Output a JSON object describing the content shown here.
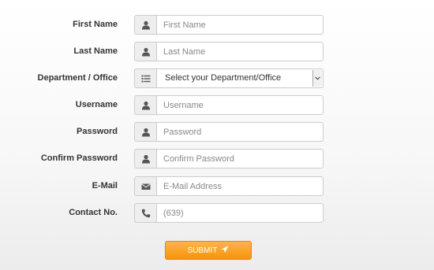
{
  "form": {
    "fields": [
      {
        "label": "First Name",
        "placeholder": "First Name",
        "icon": "user-icon"
      },
      {
        "label": "Last Name",
        "placeholder": "Last Name",
        "icon": "user-icon"
      },
      {
        "label": "Department / Office",
        "selected": "Select your Department/Office",
        "icon": "list-icon"
      },
      {
        "label": "Username",
        "placeholder": "Username",
        "icon": "user-icon"
      },
      {
        "label": "Password",
        "placeholder": "Password",
        "icon": "user-icon"
      },
      {
        "label": "Confirm Password",
        "placeholder": "Confirm Password",
        "icon": "user-icon"
      },
      {
        "label": "E-Mail",
        "placeholder": "E-Mail Address",
        "icon": "envelope-icon"
      },
      {
        "label": "Contact No.",
        "placeholder": "(639)",
        "icon": "phone-icon"
      }
    ],
    "submit_label": "SUBMIT",
    "submit_icon": "send-icon"
  },
  "colors": {
    "accent": "#f89406",
    "label_text": "#333333",
    "addon_bg": "#eeeeee",
    "border": "#cccccc"
  }
}
